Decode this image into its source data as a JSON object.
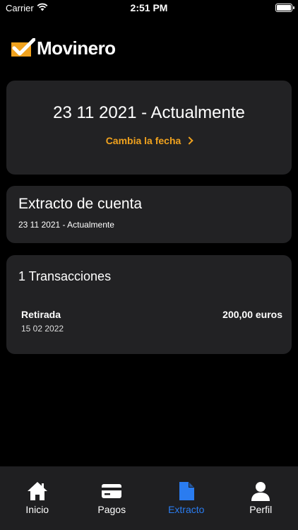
{
  "status_bar": {
    "carrier": "Carrier",
    "time": "2:51 PM"
  },
  "brand": {
    "name": "Movinero",
    "accent": "#f0a21e"
  },
  "date_card": {
    "range": "23 11 2021 - Actualmente",
    "change_label": "Cambia la fecha"
  },
  "statement": {
    "title": "Extracto de cuenta",
    "range": "23 11 2021 - Actualmente"
  },
  "transactions": {
    "title": "1 Transacciones",
    "items": [
      {
        "label": "Retirada",
        "date": "15 02 2022",
        "amount": "200,00 euros"
      }
    ]
  },
  "tabs": [
    {
      "label": "Inicio",
      "icon": "home-icon"
    },
    {
      "label": "Pagos",
      "icon": "card-icon"
    },
    {
      "label": "Extracto",
      "icon": "document-icon",
      "active": true
    },
    {
      "label": "Perfil",
      "icon": "person-icon"
    }
  ],
  "colors": {
    "active_tab": "#2a7cf0",
    "card_bg": "#222224",
    "tabbar_bg": "#1f1f21"
  }
}
